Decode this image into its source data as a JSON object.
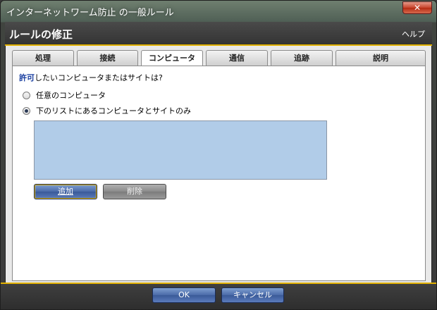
{
  "window": {
    "title": "インターネットワーム防止 の一般ルール"
  },
  "header": {
    "title": "ルールの修正",
    "help": "ヘルプ"
  },
  "tabs": [
    {
      "label": "処理"
    },
    {
      "label": "接続"
    },
    {
      "label": "コンピュータ",
      "active": true
    },
    {
      "label": "通信"
    },
    {
      "label": "追跡"
    },
    {
      "label": "説明"
    }
  ],
  "computer": {
    "question_strong": "許可",
    "question_rest": "したいコンピュータまたはサイトは?",
    "options": [
      {
        "label": "任意のコンピュータ",
        "checked": false
      },
      {
        "label": "下のリストにあるコンピュータとサイトのみ",
        "checked": true
      }
    ],
    "add_label": "追加",
    "delete_label": "削除"
  },
  "footer": {
    "ok_label": "OK",
    "cancel_label": "キャンセル"
  },
  "colors": {
    "accent": "#e0b000",
    "list_bg": "#b1cce8",
    "question_strong": "#1a3fa0"
  },
  "icons": {
    "close": "close-icon"
  }
}
